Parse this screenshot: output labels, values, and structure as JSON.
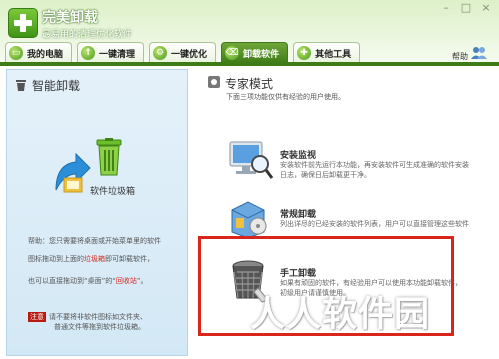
{
  "window": {
    "title": "完美卸载",
    "subtitle": "最易用的清理优化软件",
    "controls": [
      "minimize",
      "maximize",
      "close"
    ]
  },
  "tabs": [
    {
      "label": "我的电脑",
      "icon": "computer-icon",
      "active": false
    },
    {
      "label": "一键清理",
      "icon": "clean-icon",
      "active": false
    },
    {
      "label": "一键优化",
      "icon": "optimize-icon",
      "active": false
    },
    {
      "label": "卸载软件",
      "icon": "uninstall-icon",
      "active": true
    },
    {
      "label": "其他工具",
      "icon": "tools-icon",
      "active": false
    }
  ],
  "help_label": "帮助",
  "left_panel": {
    "title": "智能卸载",
    "trash_label": "软件垃圾箱",
    "help_line1": "帮助：您只需要将桌面或开始菜单里的软件",
    "help_line2_pre": "图标拖动到上面的",
    "help_line2_red": "垃圾箱",
    "help_line2_post": "即可卸载软件，",
    "help_line3_pre": "也可以直接拖动到“桌面”的“",
    "help_line3_red": "回收站",
    "help_line3_post": "”。",
    "note_badge": "注意",
    "note_line1": "请不要将非软件图标如文件夹、",
    "note_line2": "普通文件等拖到软件垃圾箱。"
  },
  "right_panel": {
    "title": "专家模式",
    "subtitle": "下面三项功能仅供有经验的用户使用。",
    "options": [
      {
        "title": "安装监视",
        "desc_line1": "安装软件前先运行本功能，再安装软件可生成准确的软件安装",
        "desc_line2": "日志，确保日后卸载更干净。",
        "icon": "monitor-icon"
      },
      {
        "title": "常规卸载",
        "desc_line1": "列出详尽的已经安装的软件列表，用户可以直接管理这些软件",
        "desc_line2": "",
        "icon": "software-box-icon"
      },
      {
        "title": "手工卸载",
        "desc_line1": "如果有顽固的软件，有经验用户可以使用本功能卸载软件，",
        "desc_line2": "初级用户请谨慎使用。",
        "icon": "shredder-icon"
      }
    ]
  },
  "watermark": "人人软件园",
  "colors": {
    "header_green": "#3f7c17",
    "accent_red": "#d9261c",
    "left_panel_blue": "#d3e8f5"
  }
}
